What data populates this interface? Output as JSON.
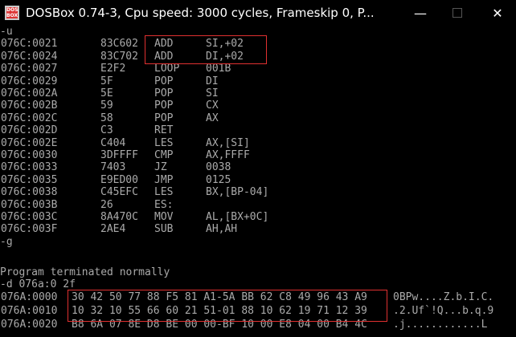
{
  "window": {
    "title": "DOSBox 0.74-3, Cpu speed:      3000 cycles, Frameskip  0, P...",
    "icon_text": "DOS BOX",
    "controls": {
      "minimize": "—",
      "close": "✕"
    }
  },
  "terminal": {
    "cmd_u": "-u",
    "disasm": [
      {
        "addr": "076C:0021",
        "opcode": "83C602",
        "mnemonic": "ADD",
        "operands": "SI,+02"
      },
      {
        "addr": "076C:0024",
        "opcode": "83C702",
        "mnemonic": "ADD",
        "operands": "DI,+02"
      },
      {
        "addr": "076C:0027",
        "opcode": "E2F2",
        "mnemonic": "LOOP",
        "operands": "001B"
      },
      {
        "addr": "076C:0029",
        "opcode": "5F",
        "mnemonic": "POP",
        "operands": "DI"
      },
      {
        "addr": "076C:002A",
        "opcode": "5E",
        "mnemonic": "POP",
        "operands": "SI"
      },
      {
        "addr": "076C:002B",
        "opcode": "59",
        "mnemonic": "POP",
        "operands": "CX"
      },
      {
        "addr": "076C:002C",
        "opcode": "58",
        "mnemonic": "POP",
        "operands": "AX"
      },
      {
        "addr": "076C:002D",
        "opcode": "C3",
        "mnemonic": "RET",
        "operands": ""
      },
      {
        "addr": "076C:002E",
        "opcode": "C404",
        "mnemonic": "LES",
        "operands": "AX,[SI]"
      },
      {
        "addr": "076C:0030",
        "opcode": "3DFFFF",
        "mnemonic": "CMP",
        "operands": "AX,FFFF"
      },
      {
        "addr": "076C:0033",
        "opcode": "7403",
        "mnemonic": "JZ",
        "operands": "0038"
      },
      {
        "addr": "076C:0035",
        "opcode": "E9ED00",
        "mnemonic": "JMP",
        "operands": "0125"
      },
      {
        "addr": "076C:0038",
        "opcode": "C45EFC",
        "mnemonic": "LES",
        "operands": "BX,[BP-04]"
      },
      {
        "addr": "076C:003B",
        "opcode": "26",
        "mnemonic": "ES:",
        "operands": ""
      },
      {
        "addr": "076C:003C",
        "opcode": "8A470C",
        "mnemonic": "MOV",
        "operands": "AL,[BX+0C]"
      },
      {
        "addr": "076C:003F",
        "opcode": "2AE4",
        "mnemonic": "SUB",
        "operands": "AH,AH"
      }
    ],
    "cmd_g": "-g",
    "blank": "",
    "terminated": "Program terminated normally",
    "cmd_d": "-d 076a:0 2f",
    "dump": [
      {
        "addr": "076A:0000",
        "bytes": "30 42 50 77 88 F5 81 A1-5A BB 62 C8 49 96 43 A9",
        "ascii": "0BPw....Z.b.I.C."
      },
      {
        "addr": "076A:0010",
        "bytes": "10 32 10 55 66 60 21 51-01 88 10 62 19 71 12 39",
        "ascii": ".2.Uf`!Q...b.q.9"
      },
      {
        "addr": "076A:0020",
        "bytes": "B8 6A 07 8E D8 BE 00 00-BF 10 00 E8 04 00 B4 4C",
        "ascii": ".j............L"
      }
    ]
  }
}
